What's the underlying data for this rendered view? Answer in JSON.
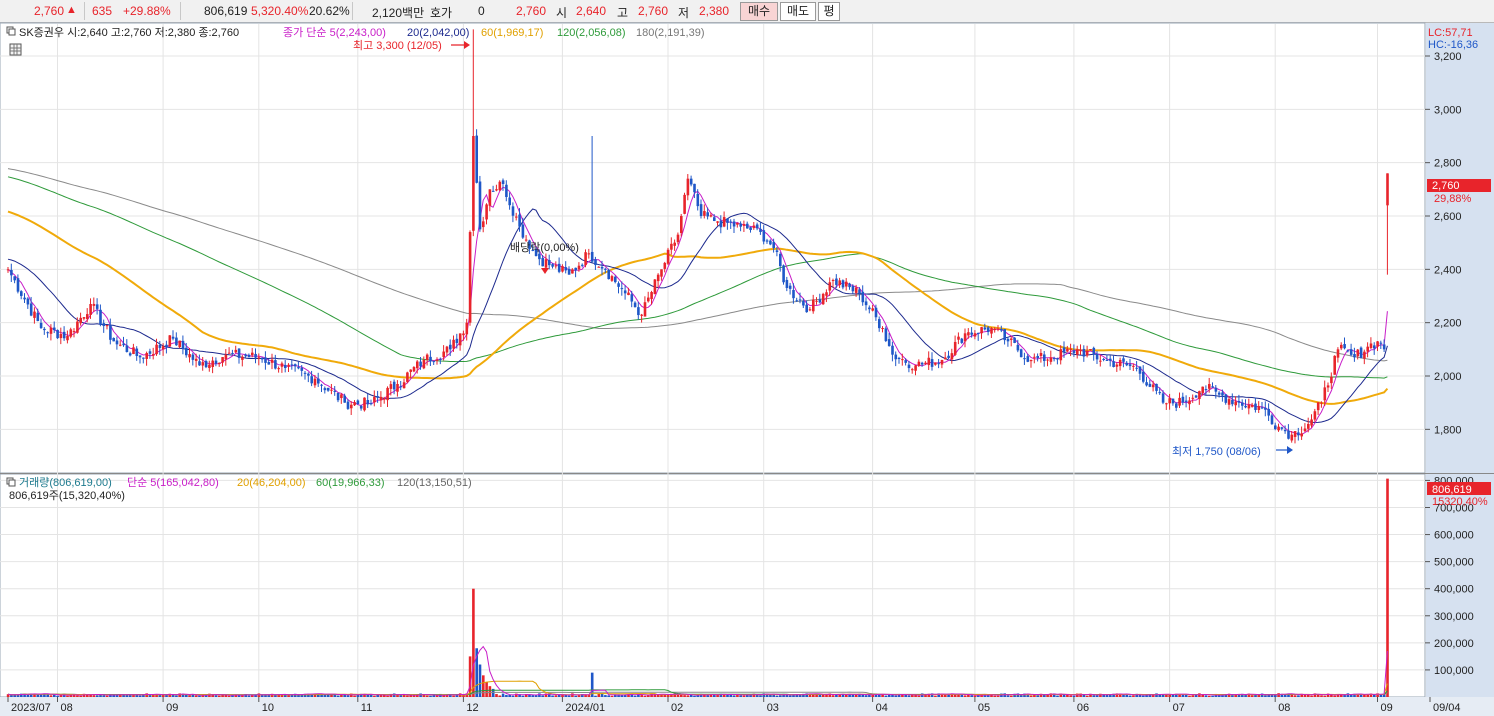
{
  "topbar": {
    "price": "2,760",
    "change": "635",
    "change_pct": "+29.88%",
    "volume": "806,619",
    "volume_pct": "5,320.40%",
    "turnover": "20.62%",
    "amount": "2,120백만",
    "hoga_label": "호가",
    "hoga_value": "0",
    "hoga_price": "2,760",
    "open_label": "시",
    "open_value": "2,640",
    "high_label": "고",
    "high_value": "2,760",
    "low_label": "저",
    "low_value": "2,380",
    "buy_label": "매수",
    "sell_label": "매도",
    "avg_label": "평"
  },
  "price_legend": {
    "stock": "SK증권우 시:2,640 고:2,760 저:2,380 종:2,760",
    "ma_title": "종가 단순 5(2,243,00)",
    "ma20": "20(2,042,00)",
    "ma60": "60(1,969,17)",
    "ma120": "120(2,056,08)",
    "ma180": "180(2,191,39)",
    "lc": "LC:57,71",
    "hc": "HC:-16,36"
  },
  "annotations": {
    "high": "최고 3,300 (12/05)",
    "low": "최저 1,750 (08/06)",
    "dividend": "배당락(0,00%)"
  },
  "price_tag": {
    "value": "2,760",
    "pct": "29,88%"
  },
  "volume_legend": {
    "title": "거래량(806,619,00)",
    "ma5": "단순 5(165,042,80)",
    "ma20": "20(46,204,00)",
    "ma60": "60(19,966,33)",
    "ma120": "120(13,150,51)",
    "sub": "806,619주(15,320,40%)"
  },
  "volume_tag": {
    "value": "806,619",
    "pct": "15320,40%"
  },
  "colors": {
    "up": "#e8242b",
    "down": "#1f57c8",
    "ma5": "#c81ec8",
    "ma20": "#1d2a8e",
    "ma60": "#f0aa0a",
    "ma120": "#2e9a3a",
    "ma180": "#8a8a8a",
    "grid": "#e4e4e4",
    "axis_panel": "#d6e1f0"
  },
  "chart_data": [
    {
      "type": "candlestick",
      "title": "SK증권우",
      "y_ticks": [
        1800,
        2000,
        2200,
        2400,
        2600,
        2800,
        3000,
        3200
      ],
      "y_tick_labels": [
        "1,800",
        "2,000",
        "2,200",
        "2,400",
        "2,600",
        "2,800",
        "3,000",
        "3,200"
      ],
      "ylim": [
        1640,
        3320
      ],
      "x_tick_labels": [
        "2023/07",
        "08",
        "09",
        "10",
        "11",
        "12",
        "2024/01",
        "02",
        "03",
        "04",
        "05",
        "06",
        "07",
        "08",
        "09",
        "09/04"
      ],
      "close_anchors": [
        [
          0,
          2400
        ],
        [
          10,
          2180
        ],
        [
          18,
          2150
        ],
        [
          25,
          2270
        ],
        [
          32,
          2130
        ],
        [
          40,
          2070
        ],
        [
          50,
          2140
        ],
        [
          58,
          2040
        ],
        [
          66,
          2080
        ],
        [
          76,
          2070
        ],
        [
          84,
          2030
        ],
        [
          93,
          1990
        ],
        [
          102,
          1900
        ],
        [
          110,
          1895
        ],
        [
          118,
          1970
        ],
        [
          126,
          2060
        ],
        [
          134,
          2100
        ],
        [
          139,
          2200
        ],
        [
          141,
          2900
        ],
        [
          143,
          2550
        ],
        [
          146,
          2700
        ],
        [
          150,
          2720
        ],
        [
          155,
          2560
        ],
        [
          160,
          2450
        ],
        [
          165,
          2410
        ],
        [
          170,
          2380
        ],
        [
          176,
          2460
        ],
        [
          181,
          2400
        ],
        [
          187,
          2310
        ],
        [
          192,
          2230
        ],
        [
          198,
          2400
        ],
        [
          203,
          2530
        ],
        [
          206,
          2740
        ],
        [
          210,
          2600
        ],
        [
          215,
          2580
        ],
        [
          222,
          2560
        ],
        [
          228,
          2540
        ],
        [
          232,
          2480
        ],
        [
          236,
          2330
        ],
        [
          243,
          2250
        ],
        [
          250,
          2360
        ],
        [
          258,
          2310
        ],
        [
          265,
          2180
        ],
        [
          268,
          2080
        ],
        [
          275,
          2040
        ],
        [
          283,
          2060
        ],
        [
          290,
          2160
        ],
        [
          298,
          2180
        ],
        [
          303,
          2130
        ],
        [
          310,
          2060
        ],
        [
          316,
          2070
        ],
        [
          324,
          2100
        ],
        [
          332,
          2060
        ],
        [
          342,
          2030
        ],
        [
          350,
          1900
        ],
        [
          356,
          1900
        ],
        [
          362,
          1960
        ],
        [
          367,
          1930
        ],
        [
          373,
          1900
        ],
        [
          380,
          1880
        ],
        [
          385,
          1810
        ],
        [
          389,
          1780
        ],
        [
          394,
          1820
        ],
        [
          398,
          1900
        ],
        [
          403,
          2100
        ],
        [
          408,
          2070
        ],
        [
          412,
          2110
        ],
        [
          415,
          2130
        ],
        [
          417,
          2100
        ],
        [
          418,
          2760
        ]
      ],
      "ma_periods": [
        5,
        20,
        60,
        120,
        180
      ]
    },
    {
      "type": "bar",
      "title": "거래량",
      "y_ticks": [
        100000,
        200000,
        300000,
        400000,
        500000,
        600000,
        700000,
        800000
      ],
      "y_tick_labels": [
        "100,000",
        "200,000",
        "300,000",
        "400,000",
        "500,000",
        "600,000",
        "700,000",
        "800,000"
      ],
      "ylim": [
        0,
        820000
      ],
      "baseline_volume": 9000,
      "spikes": [
        [
          140,
          150000
        ],
        [
          141,
          400000
        ],
        [
          142,
          180000
        ],
        [
          143,
          120000
        ],
        [
          144,
          80000
        ],
        [
          145,
          55000
        ],
        [
          146,
          40000
        ],
        [
          147,
          30000
        ],
        [
          177,
          90000
        ],
        [
          331,
          12000
        ],
        [
          385,
          14000
        ],
        [
          418,
          806619
        ]
      ]
    }
  ]
}
